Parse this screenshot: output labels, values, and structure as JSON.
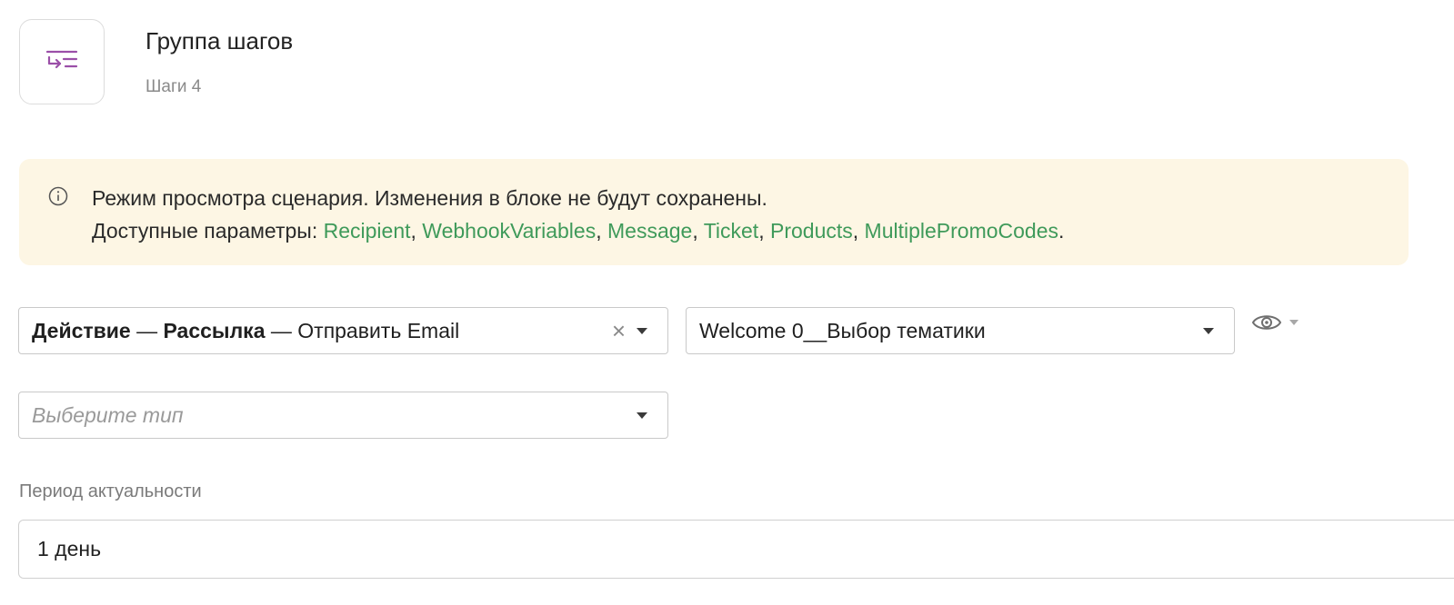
{
  "header": {
    "icon": "step-group-icon",
    "title": "Группа шагов",
    "steps_count": "Шаги 4"
  },
  "notice": {
    "icon": "info-icon",
    "message": "Режим просмотра сценария. Изменения в блоке не будут сохранены.",
    "params_label": "Доступные параметры: ",
    "params": [
      "Recipient",
      "WebhookVariables",
      "Message",
      "Ticket",
      "Products",
      "MultiplePromoCodes"
    ],
    "params_end": ".",
    "colors": {
      "background": "#fdf6e4",
      "link": "#3f9a5a"
    }
  },
  "action_select": {
    "part1": "Действие",
    "sep1": " — ",
    "part2": "Рассылка",
    "sep2": " — ",
    "part3": "Отправить Email",
    "clear_icon": "×"
  },
  "template_select": {
    "value": "Welcome 0__Выбор тематики"
  },
  "preview": {
    "icon": "eye-icon"
  },
  "type_select": {
    "placeholder": "Выберите тип"
  },
  "relevance_period": {
    "label": "Период актуальности",
    "value": "1 день"
  }
}
